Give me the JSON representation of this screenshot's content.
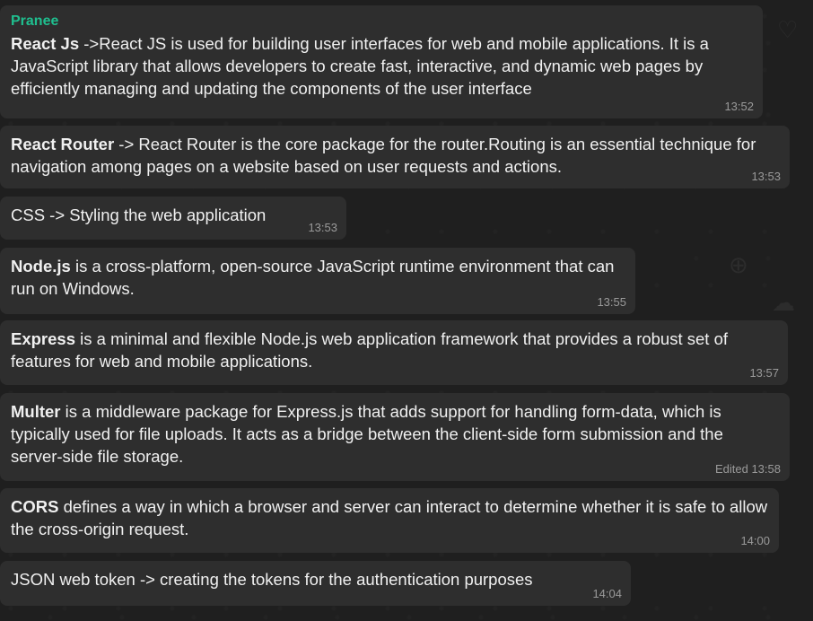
{
  "messages": [
    {
      "sender": "Pranee",
      "term": "React Js",
      "text": "  ->React JS is used for building user interfaces for web and mobile applications. It is a JavaScript library that allows developers to create fast, interactive, and dynamic web pages by efficiently managing and updating the components of the user interface",
      "time": "13:52"
    },
    {
      "term": "React Router",
      "text": "  -> React Router is the core package for the router.Routing is an essential technique for navigation among pages on a website based on user requests and actions.",
      "time": "13:53"
    },
    {
      "term": "",
      "text": "CSS -> Styling the web application",
      "time": "13:53"
    },
    {
      "term": "Node.js",
      "text": " is a cross-platform, open-source JavaScript runtime environment that can run on Windows.",
      "time": "13:55"
    },
    {
      "term": "Express",
      "text": " is a minimal and flexible Node.js web application framework that provides a robust set of features for web and mobile applications.",
      "time": "13:57"
    },
    {
      "term": "Multer",
      "text": " is a middleware package for Express.js that adds support for handling form-data, which is typically used for file uploads. It acts as a bridge between the client-side form submission and the server-side file storage.",
      "time": "Edited 13:58"
    },
    {
      "term": "CORS",
      "text": " defines a way in which a browser and server can interact to determine whether it is safe to allow the cross-origin request.",
      "time": "14:00"
    },
    {
      "term": "",
      "text": "JSON web token -> creating the tokens for the authentication purposes",
      "time": "14:04"
    }
  ],
  "icons": {
    "background_pattern": [
      "heart-icon",
      "compass-icon",
      "cloud-icon"
    ]
  }
}
